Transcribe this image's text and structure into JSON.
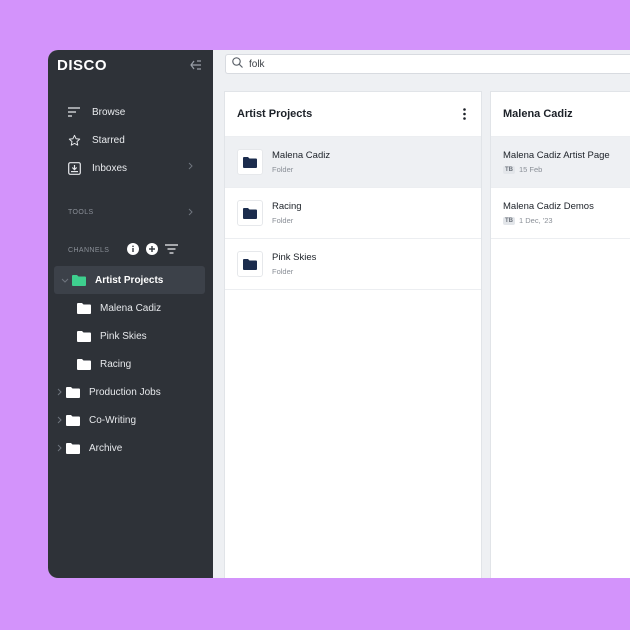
{
  "app": {
    "name": "DISCO"
  },
  "sidebar": {
    "nav": [
      {
        "label": "Browse",
        "icon": "browse-icon"
      },
      {
        "label": "Starred",
        "icon": "star-icon"
      },
      {
        "label": "Inboxes",
        "icon": "inbox-icon"
      }
    ],
    "tools_label": "TOOLS",
    "channels_label": "CHANNELS",
    "tree": [
      {
        "label": "Artist Projects",
        "expanded": true,
        "active": true
      },
      {
        "label": "Malena Cadiz",
        "child": true
      },
      {
        "label": "Pink Skies",
        "child": true
      },
      {
        "label": "Racing",
        "child": true
      },
      {
        "label": "Production Jobs"
      },
      {
        "label": "Co-Writing"
      },
      {
        "label": "Archive"
      }
    ]
  },
  "search": {
    "value": "folk"
  },
  "panel1": {
    "title": "Artist Projects",
    "rows": [
      {
        "title": "Malena Cadiz",
        "subtitle": "Folder",
        "selected": true
      },
      {
        "title": "Racing",
        "subtitle": "Folder"
      },
      {
        "title": "Pink Skies",
        "subtitle": "Folder"
      }
    ]
  },
  "panel2": {
    "title": "Malena Cadiz",
    "rows": [
      {
        "title": "Malena Cadiz Artist Page",
        "badge": "TB",
        "date": "15 Feb",
        "selected": true
      },
      {
        "title": "Malena Cadiz Demos",
        "badge": "TB",
        "date": "1 Dec, '23"
      }
    ]
  },
  "colors": {
    "background": "#d393fb",
    "sidebar": "#2e3238",
    "accent_folder": "#3ecf8e",
    "folder_dark": "#1b2c4d"
  }
}
